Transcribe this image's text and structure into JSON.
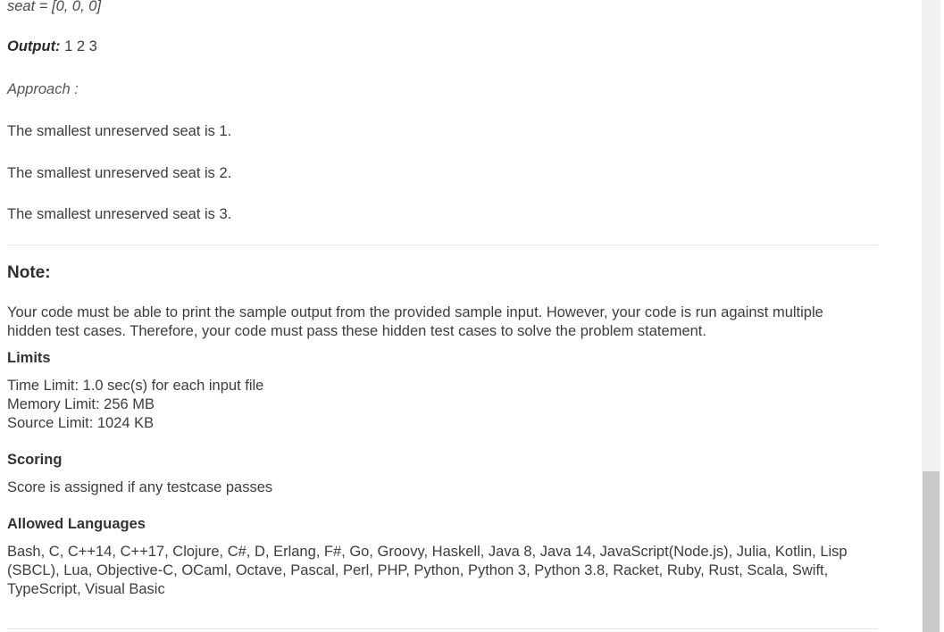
{
  "example": {
    "seat_line": "seat = [0, 0, 0]",
    "output_label": "Output:",
    "output_value": " 1 2 3",
    "approach_label": "Approach :",
    "steps": [
      "The smallest unreserved seat is 1.",
      "The smallest unreserved seat is 2.",
      "The smallest unreserved seat is 3."
    ]
  },
  "note": {
    "title": "Note:",
    "text": "Your code must be able to print the sample output from the provided sample input. However, your code is run against multiple hidden test cases. Therefore, your code must pass these hidden test cases to solve the problem statement."
  },
  "limits": {
    "heading": "Limits",
    "time": "Time Limit: 1.0 sec(s) for each input file",
    "memory": "Memory Limit: 256 MB",
    "source": "Source Limit: 1024 KB"
  },
  "scoring": {
    "heading": "Scoring",
    "text": "Score is assigned if any testcase passes"
  },
  "languages": {
    "heading": "Allowed Languages",
    "text": "Bash, C, C++14, C++17, Clojure, C#, D, Erlang, F#, Go, Groovy, Haskell, Java 8, Java 14, JavaScript(Node.js), Julia, Kotlin, Lisp (SBCL), Lua, Objective-C, OCaml, Octave, Pascal, Perl, PHP, Python, Python 3, Python 3.8, Racket, Ruby, Rust, Scala, Swift, TypeScript, Visual Basic"
  },
  "scrollbar": {
    "thumb_color": "#c9c9c9",
    "track_color": "#f1f1f1"
  }
}
